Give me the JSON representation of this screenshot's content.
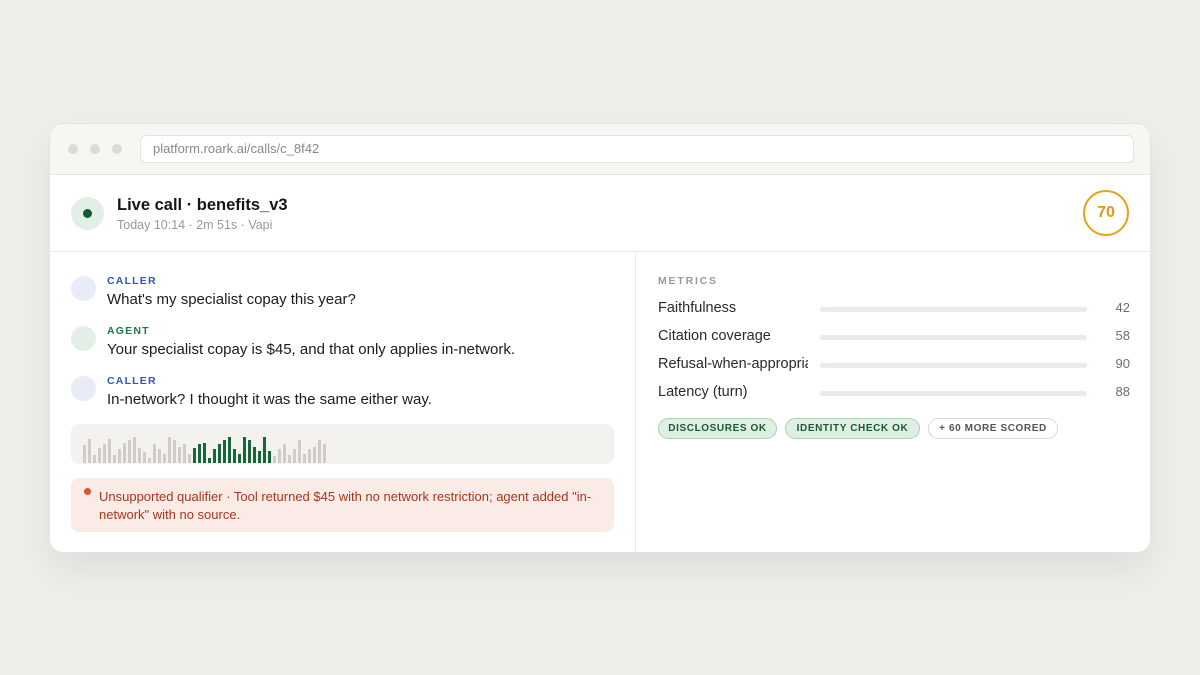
{
  "browser": {
    "url": "platform.roark.ai/calls/c_8f42"
  },
  "call": {
    "title": "Live call · benefits_v3",
    "meta": "Today 10:14 · 2m 51s · Vapi",
    "score": "70",
    "score_color": "#e8a31b"
  },
  "transcript": [
    {
      "speaker": "CALLER",
      "role": "caller",
      "text": "What's my specialist copay this year?"
    },
    {
      "speaker": "AGENT",
      "role": "agent",
      "text": "Your specialist copay is $45, and that only applies in-network."
    },
    {
      "speaker": "CALLER",
      "role": "caller",
      "text": "In-network? I thought it was the same either way."
    }
  ],
  "waveform": {
    "levels": [
      0.65,
      0.9,
      0.3,
      0.55,
      0.7,
      0.9,
      0.3,
      0.5,
      0.75,
      0.85,
      0.95,
      0.55,
      0.4,
      0.2,
      0.7,
      0.5,
      0.35,
      0.95,
      0.85,
      0.6,
      0.7,
      0.35,
      0.55,
      0.7,
      0.75,
      0.2,
      0.5,
      0.7,
      0.85,
      0.95,
      0.5,
      0.35,
      0.95,
      0.85,
      0.6,
      0.45,
      0.95,
      0.45,
      0.25,
      0.5,
      0.7,
      0.3,
      0.5,
      0.85,
      0.35,
      0.5,
      0.6,
      0.85,
      0.7
    ],
    "active_range": [
      22,
      37
    ],
    "inactive_color": "#cfcdc6",
    "active_color": "#16663a"
  },
  "alert": {
    "text": "Unsupported qualifier · Tool returned $45 with no network restriction; agent added \"in-network\" with no source.",
    "color": "#e2502e"
  },
  "metrics": {
    "heading": "METRICS",
    "items": [
      {
        "label": "Faithfulness",
        "value": 42,
        "fill_fraction": 0.42,
        "color": "#e2502e"
      },
      {
        "label": "Citation coverage",
        "value": 58,
        "fill_fraction": 0.58,
        "color": "#e2502e"
      },
      {
        "label": "Refusal-when-appropriate",
        "value": 90,
        "fill_fraction": 0.9,
        "color": "#16663a"
      },
      {
        "label": "Latency (turn)",
        "value": 88,
        "fill_fraction": 0.88,
        "color": "#16663a"
      }
    ]
  },
  "chips": [
    {
      "label": "DISCLOSURES OK",
      "kind": "ok"
    },
    {
      "label": "IDENTITY CHECK OK",
      "kind": "ok"
    },
    {
      "label": "+ 60 MORE SCORED",
      "kind": "more"
    }
  ]
}
